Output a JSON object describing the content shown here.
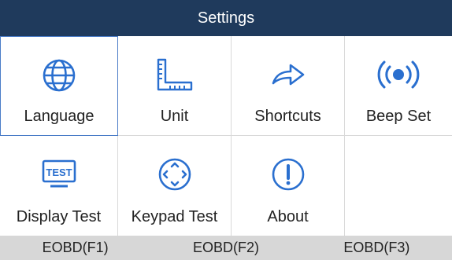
{
  "title": "Settings",
  "colors": {
    "title_bg": "#1f3a5c",
    "icon_blue": "#2a6fcf",
    "selected_border": "#4a7cc7",
    "footer_bg": "#d7d7d7"
  },
  "items": [
    {
      "label": "Language",
      "icon": "globe-icon",
      "selected": true
    },
    {
      "label": "Unit",
      "icon": "ruler-icon"
    },
    {
      "label": "Shortcuts",
      "icon": "arrow-right-icon"
    },
    {
      "label": "Beep Set",
      "icon": "beep-icon"
    },
    {
      "label": "Display Test",
      "icon": "test-display-icon",
      "icon_text": "TEST"
    },
    {
      "label": "Keypad Test",
      "icon": "keypad-icon"
    },
    {
      "label": "About",
      "icon": "info-exclamation-icon"
    }
  ],
  "footer": {
    "f1": "EOBD(F1)",
    "f2": "EOBD(F2)",
    "f3": "EOBD(F3)"
  }
}
